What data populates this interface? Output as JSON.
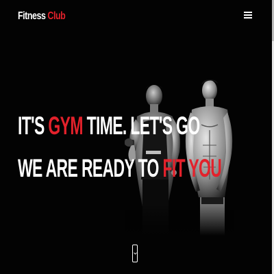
{
  "header": {
    "logo_main": "Fitness",
    "logo_accent": "Club",
    "menu_icon": "hamburger-menu-icon"
  },
  "hero": {
    "line1": {
      "before": "IT'S ",
      "accent": "GYM",
      "after": " TIME. LET'S GO"
    },
    "line2": {
      "before": "WE ARE READY TO ",
      "accent": "FIT YOU"
    },
    "scroll_icon": "chevron-down-icon"
  },
  "colors": {
    "background": "#030303",
    "text": "#ffffff",
    "accent": "#e3212b"
  }
}
